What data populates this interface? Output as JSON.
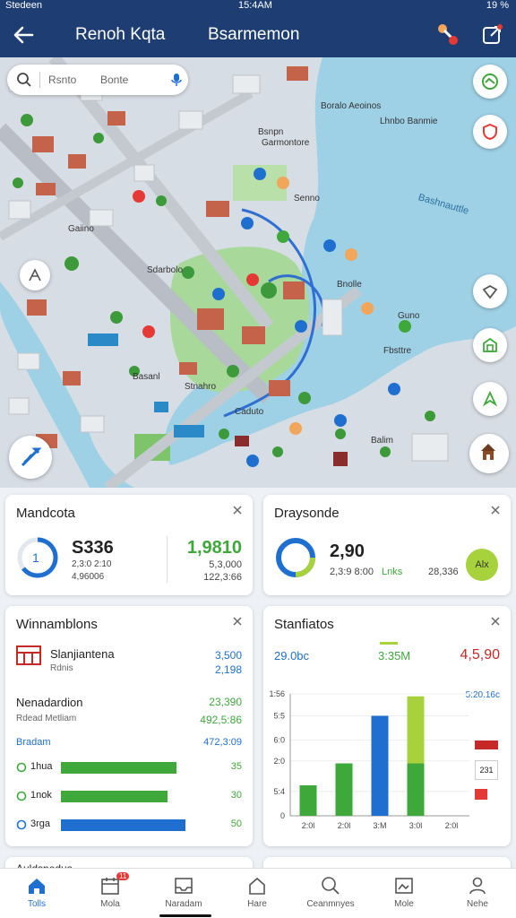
{
  "status_bar": {
    "carrier": "Stedeen",
    "time": "15:4AM",
    "battery": "19 %"
  },
  "header": {
    "title": "Renoh Kqta",
    "subtitle": "Bsarmemon"
  },
  "map": {
    "search": {
      "text1": "Rsnto",
      "text2": "Bonte"
    },
    "labels": [
      "Boralo Aeoinos",
      "Lhnbo Banmie",
      "Bsnpn",
      "Garmontore",
      "Senno",
      "Gaiino",
      "Sdarbolo",
      "Bnolle",
      "Guno",
      "Fbsttre",
      "Basanl",
      "Stnahro",
      "Caduto",
      "Balim"
    ],
    "water_label": "Bashnauttle"
  },
  "cards": {
    "mandcota": {
      "title": "Mandcota",
      "value": "S336",
      "sub1": "2,3:0 2:10",
      "sub2": "4,96006",
      "right_value": "1,9810",
      "right_sub1": "5,3,000",
      "right_sub2": "122,3:66",
      "ring_label": "1"
    },
    "draysonde": {
      "title": "Draysonde",
      "value": "2,90",
      "sub1": "2,3:9 8:00",
      "sub1b": "Lnks",
      "sub2": "28,336",
      "chip": "Alx"
    },
    "winnamblons": {
      "title": "Winnamblons",
      "item_title": "Slanjiantena",
      "item_sub": "Rdnis",
      "item_value": "3,500",
      "item_value2": "2,198",
      "sec2_title": "Nenadardion",
      "sec2_sub": "Rdead Metliam",
      "sec2_value": "23,390",
      "sec2_value2": "492,5:86",
      "sec3_title": "Bradam",
      "sec3_value": "472,3:09",
      "bars": [
        {
          "label": "1hua",
          "value": "35",
          "fill": 0.92,
          "color": "#3fa83b"
        },
        {
          "label": "1nok",
          "value": "30",
          "fill": 0.85,
          "color": "#3fa83b"
        },
        {
          "label": "3rga",
          "value": "50",
          "fill": 0.99,
          "color": "#1f6fd1"
        }
      ]
    },
    "stanfiatos": {
      "title": "Stanfiatos",
      "stat1": "29.0bc",
      "stat2": "3:35M",
      "stat3": "4,5,90",
      "legend_value": "5:20.16c",
      "legend_tag": "231"
    },
    "partial_left": {
      "title": "Auldspedus"
    }
  },
  "chart_data": {
    "type": "bar",
    "categories": [
      "2:0l",
      "2:0l",
      "3:M",
      "3:0l",
      "2:0l"
    ],
    "yticks": [
      "0",
      "5:4",
      "2:0",
      "6:0",
      "5:5",
      "1:56"
    ],
    "series": [
      {
        "values": [
          25,
          43,
          72,
          0,
          0
        ],
        "color": "#3fa83b"
      },
      {
        "values": [
          0,
          0,
          82,
          0,
          0
        ],
        "color": "#1f6fd1"
      },
      {
        "values": [
          0,
          0,
          0,
          43,
          0
        ],
        "color": "#3fa83b"
      },
      {
        "values": [
          0,
          0,
          0,
          55,
          0
        ],
        "color": "#a8d23c"
      }
    ],
    "ylim": [
      0,
      100
    ]
  },
  "bottom_nav": [
    {
      "label": "Tolls",
      "icon": "home-icon",
      "active": true
    },
    {
      "label": "Mola",
      "icon": "calendar-icon",
      "badge": "11"
    },
    {
      "label": "Naradam",
      "icon": "inbox-icon"
    },
    {
      "label": "Hare",
      "icon": "house-icon"
    },
    {
      "label": "Ceanmnyes",
      "icon": "search-icon"
    },
    {
      "label": "Mole",
      "icon": "image-icon"
    },
    {
      "label": "Nehe",
      "icon": "user-icon"
    }
  ],
  "colors": {
    "primary": "#1e3d73",
    "accent_green": "#3fa83b",
    "accent_blue": "#1f6fd1",
    "accent_red": "#c62828"
  }
}
